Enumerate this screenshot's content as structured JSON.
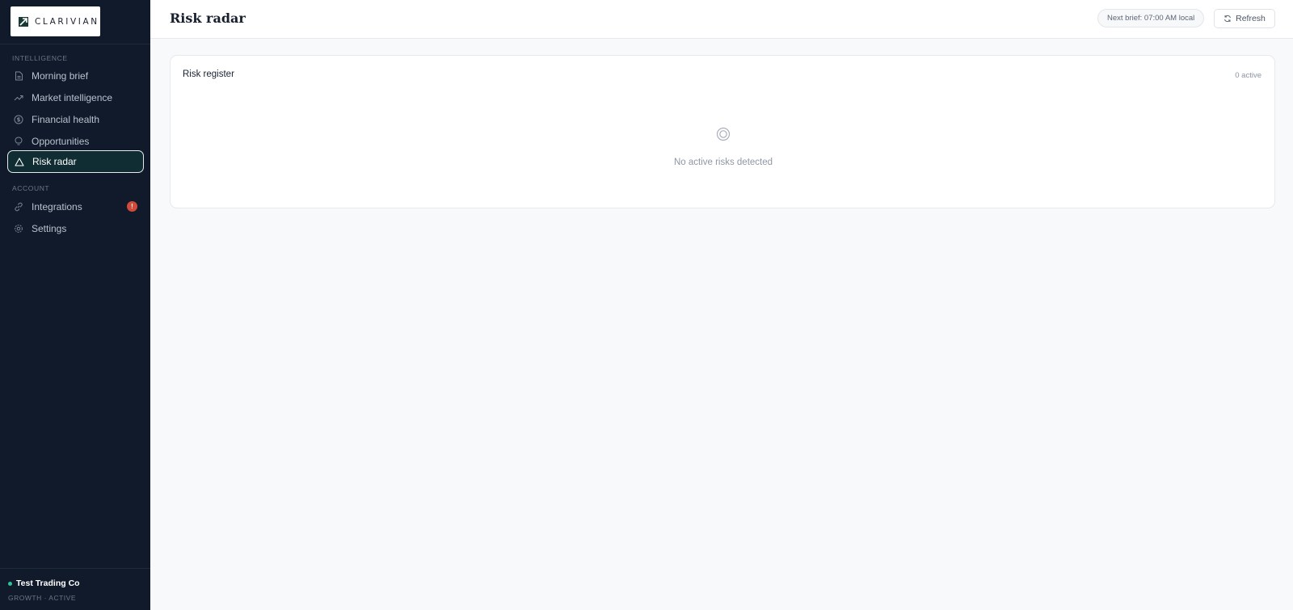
{
  "brand": {
    "name": "CLARIVIAN"
  },
  "sidebar": {
    "sections": [
      {
        "label": "INTELLIGENCE"
      },
      {
        "label": "ACCOUNT"
      }
    ],
    "items": [
      {
        "label": "Morning brief",
        "icon": "document-icon"
      },
      {
        "label": "Market intelligence",
        "icon": "trending-up-icon"
      },
      {
        "label": "Financial health",
        "icon": "dollar-circle-icon"
      },
      {
        "label": "Opportunities",
        "icon": "lightbulb-icon"
      },
      {
        "label": "Risk radar",
        "icon": "warning-triangle-icon",
        "active": true
      },
      {
        "label": "Integrations",
        "icon": "link-icon",
        "badge": "!"
      },
      {
        "label": "Settings",
        "icon": "gear-icon"
      }
    ],
    "org": {
      "name": "Test Trading Co",
      "status": "GROWTH · ACTIVE"
    }
  },
  "header": {
    "title": "Risk radar",
    "next_brief": "Next brief: 07:00 AM local",
    "refresh_label": "Refresh"
  },
  "card": {
    "title": "Risk register",
    "count": "0 active",
    "empty_message": "No active risks detected"
  },
  "colors": {
    "sidebar_bg": "#111a2a",
    "active_bg": "#0f2d33",
    "badge": "#d14a3a",
    "status_dot": "#2fc29a"
  }
}
